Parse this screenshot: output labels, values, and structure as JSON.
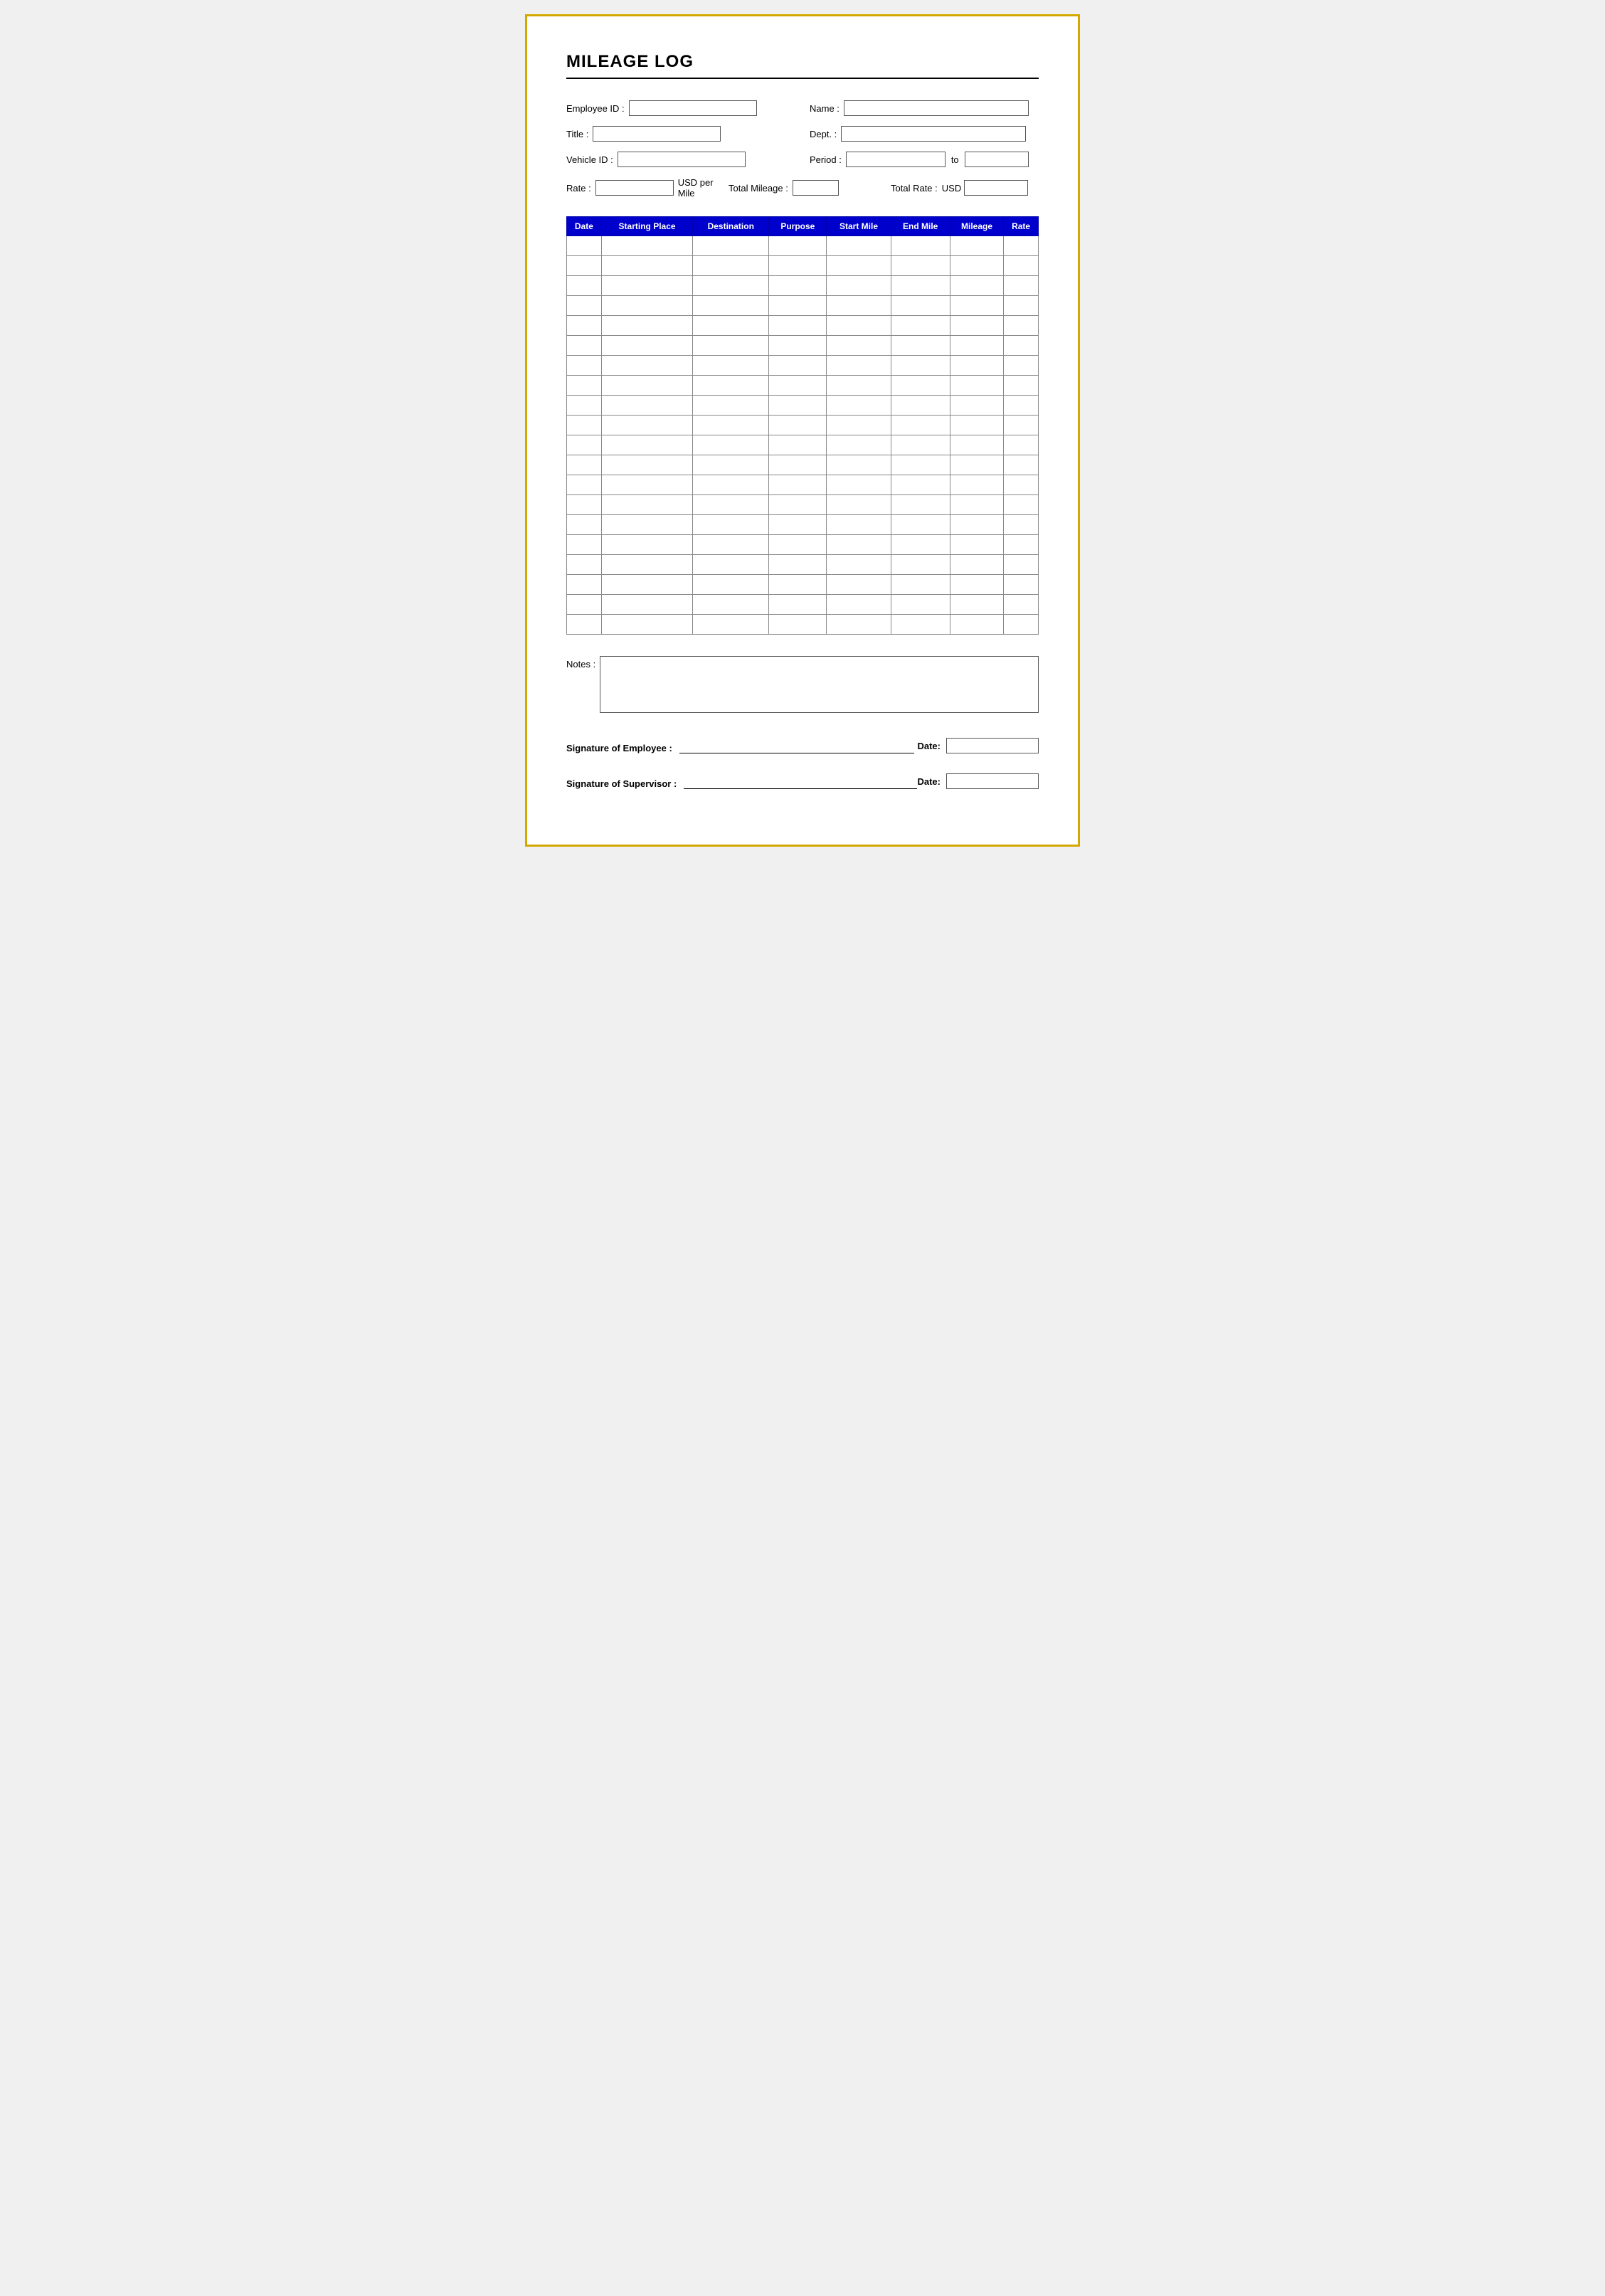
{
  "title": "MILEAGE LOG",
  "form": {
    "employee_id_label": "Employee ID :",
    "name_label": "Name :",
    "title_label": "Title :",
    "dept_label": "Dept. :",
    "vehicle_id_label": "Vehicle ID :",
    "period_label": "Period :",
    "period_to": "to",
    "rate_label": "Rate :",
    "usd_per_mile": "USD per Mile",
    "total_mileage_label": "Total Mileage :",
    "total_rate_label": "Total Rate :",
    "usd_label": "USD"
  },
  "table": {
    "headers": [
      "Date",
      "Starting Place",
      "Destination",
      "Purpose",
      "Start Mile",
      "End Mile",
      "Mileage",
      "Rate"
    ],
    "rows": 20
  },
  "notes": {
    "label": "Notes :"
  },
  "signatures": {
    "employee_label": "Signature of Employee :",
    "supervisor_label": "Signature of Supervisor :",
    "date_label": "Date:"
  }
}
